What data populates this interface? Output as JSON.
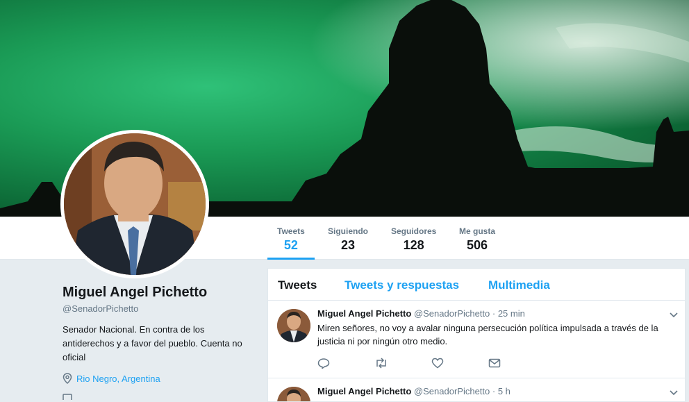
{
  "profile": {
    "name": "Miguel Angel Pichetto",
    "handle": "@SenadorPichetto",
    "bio": "Senador Nacional. En contra de los antiderechos y a favor del pueblo. Cuenta no oficial",
    "location": "Rio Negro, Argentina"
  },
  "stats": [
    {
      "label": "Tweets",
      "value": "52"
    },
    {
      "label": "Siguiendo",
      "value": "23"
    },
    {
      "label": "Seguidores",
      "value": "128"
    },
    {
      "label": "Me gusta",
      "value": "506"
    }
  ],
  "tabs": [
    {
      "label": "Tweets"
    },
    {
      "label": "Tweets y respuestas"
    },
    {
      "label": "Multimedia"
    }
  ],
  "tweets": [
    {
      "name": "Miguel Angel Pichetto",
      "handle": "@SenadorPichetto",
      "time": "· 25 min",
      "text": "Miren señores, no voy a avalar ninguna persecución política impulsada a través de la justicia ni por ningún otro medio."
    },
    {
      "name": "Miguel Angel Pichetto",
      "handle": "@SenadorPichetto",
      "time": "· 5 h",
      "text": ""
    }
  ],
  "colors": {
    "accent": "#1da1f2",
    "banner_green": "#1a9a55",
    "background": "#e6ecf0"
  }
}
